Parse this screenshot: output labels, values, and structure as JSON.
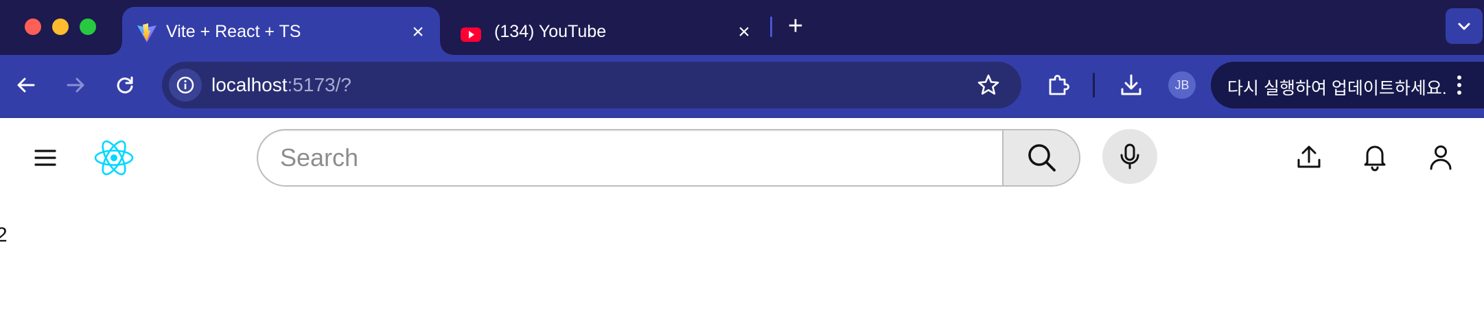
{
  "browser": {
    "tabs": [
      {
        "title": "Vite + React + TS",
        "favicon": "vite-logo-icon",
        "active": true
      },
      {
        "title": "(134) YouTube",
        "favicon": "youtube-logo-icon",
        "active": false
      }
    ],
    "new_tab_label": "+",
    "close_glyph": "×",
    "address_bar": {
      "host": "localhost",
      "rest": ":5173/?"
    },
    "profile_initials": "JB",
    "update_prompt": "다시 실행하여 업데이트하세요.",
    "colors": {
      "tab_strip": "#1c1a4f",
      "active_tab": "#343ea9",
      "omnibox": "#282d72",
      "update_chip": "#16174a"
    }
  },
  "app": {
    "logo": "react-logo-icon",
    "search": {
      "placeholder": "Search",
      "value": ""
    },
    "icons": [
      "menu-icon",
      "search-icon",
      "microphone-icon",
      "upload-icon",
      "bell-icon",
      "user-icon"
    ],
    "body_text": "2",
    "colors": {
      "react_logo": "#00d8ff"
    }
  }
}
